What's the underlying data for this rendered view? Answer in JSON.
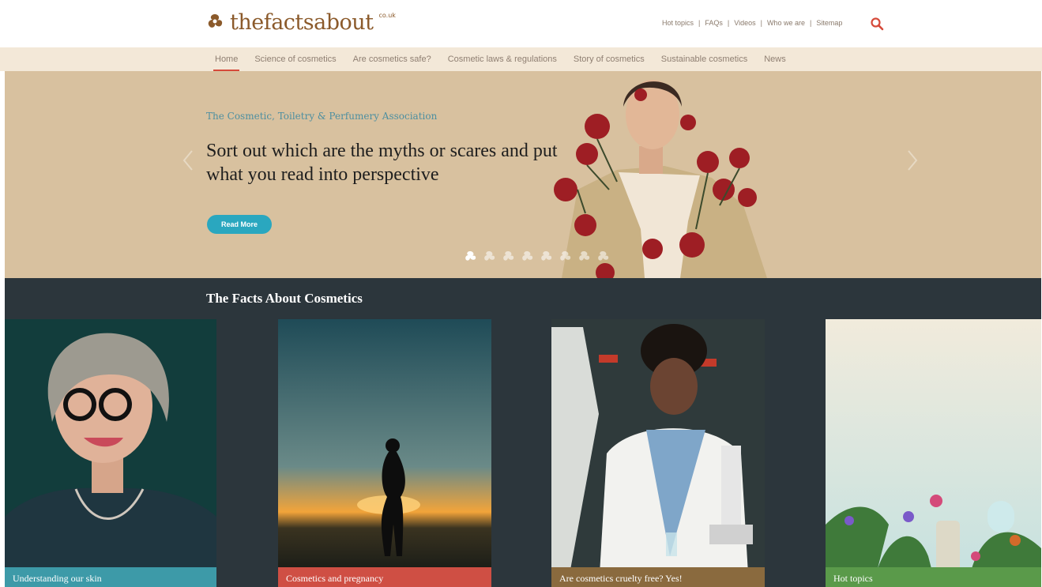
{
  "header": {
    "logo_text": "thefactsabout",
    "logo_tld": "co.uk",
    "util_links": [
      "Hot topics",
      "FAQs",
      "Videos",
      "Who we are",
      "Sitemap"
    ],
    "search_icon": "search-icon"
  },
  "nav": {
    "items": [
      "Home",
      "Science of cosmetics",
      "Are cosmetics safe?",
      "Cosmetic laws & regulations",
      "Story of cosmetics",
      "Sustainable cosmetics",
      "News"
    ],
    "active": "Home"
  },
  "hero": {
    "org": "The Cosmetic, Toiletry & Perfumery Association",
    "headline": "Sort out which are the myths or scares and put what you read into perspective",
    "button_label": "Read More",
    "slide_count": 8,
    "active_slide": 1
  },
  "facts": {
    "title": "The Facts About Cosmetics",
    "cards": [
      {
        "caption": "Understanding our skin",
        "color": "#3d9aa8"
      },
      {
        "caption": "Cosmetics and pregnancy",
        "color": "#cf4f44"
      },
      {
        "caption": "Are cosmetics cruelty free? Yes!",
        "color": "#8a6a3e"
      },
      {
        "caption": "Hot topics",
        "color": "#5a9a4a"
      }
    ]
  },
  "colors": {
    "accent_red": "#d64a3a",
    "button_teal": "#2aa7bf",
    "hero_bg": "#d8c19f",
    "nav_bg": "#f3e8d8",
    "dark_bg": "#2c363c"
  }
}
